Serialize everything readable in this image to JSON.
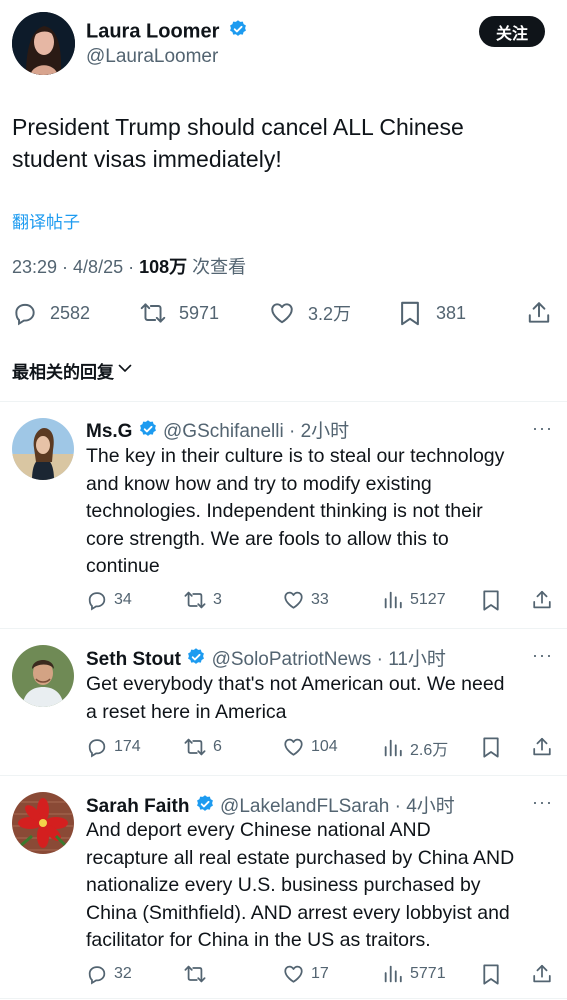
{
  "main_post": {
    "author_name": "Laura Loomer",
    "handle": "@LauraLoomer",
    "follow_label": "关注",
    "text_line1": "President Trump should cancel ALL Chinese",
    "text_line2": "student visas immediately!",
    "translate_label": "翻译帖子",
    "timestamp": "23:29 · 4/8/25 · ",
    "views_count": "108万",
    "views_label": " 次查看",
    "stats": {
      "replies": "2582",
      "reposts": "5971",
      "likes": "3.2万",
      "bookmarks": "381"
    },
    "sort_label": "最相关的回复"
  },
  "replies": [
    {
      "name": "Ms.G",
      "handle": "@GSchifanelli",
      "time": "· 2小时",
      "lines": [
        "The key in their culture is to steal our technology",
        "and know how and try to modify existing",
        "technologies. Independent thinking is not their",
        "core strength. We are fools to allow this to",
        "continue"
      ],
      "replies": "34",
      "reposts": "3",
      "likes": "33",
      "views": "5127"
    },
    {
      "name": "Seth Stout",
      "handle": "@SoloPatriotNews",
      "time": "· 11小时",
      "lines": [
        "Get everybody that's not American out. We need",
        "a reset here in America"
      ],
      "replies": "174",
      "reposts": "6",
      "likes": "104",
      "views": "2.6万"
    },
    {
      "name": "Sarah Faith",
      "handle": "@LakelandFLSarah",
      "time": "· 4小时",
      "lines": [
        "And deport every Chinese national AND",
        "recapture all real estate purchased by China AND",
        "nationalize every U.S. business purchased by",
        "China (Smithfield). AND arrest every lobbyist and",
        "facilitator for China in the US as traitors."
      ],
      "replies": "32",
      "reposts": "",
      "likes": "17",
      "views": "5771"
    }
  ],
  "colors": {
    "link": "#1d9bf0",
    "verified": "#1d9bf0",
    "muted": "#536471",
    "text": "#0f1419"
  }
}
